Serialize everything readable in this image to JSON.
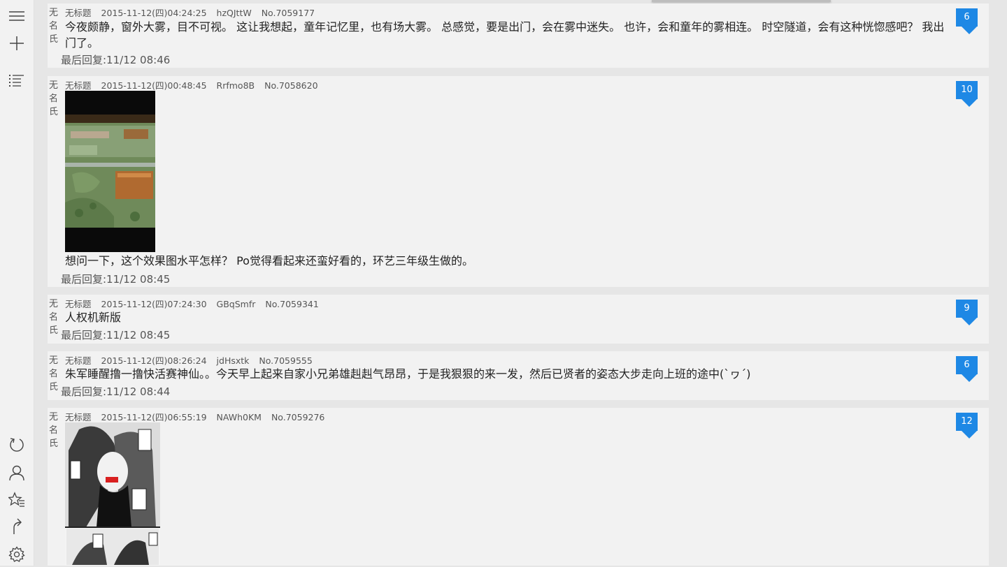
{
  "sidebar": {
    "top": [
      "menu-icon",
      "add-icon",
      "list-icon"
    ],
    "bottom": [
      "refresh-icon",
      "user-icon",
      "favorites-icon",
      "redo-icon",
      "settings-icon"
    ]
  },
  "posts": [
    {
      "author": "无名氏",
      "title": "无标题",
      "time": "2015-11-12(四)04:24:25",
      "uid": "hzQJttW",
      "no": "No.7059177",
      "content": "今夜颇静，窗外大雾，目不可视。 这让我想起，童年记忆里，也有场大雾。 总感觉，要是出门，会在雾中迷失。 也许，会和童年的雾相连。 时空隧道，会有这种恍惚感吧？ 我出门了。",
      "last_reply": "最后回复:11/12 08:46",
      "replies": "6"
    },
    {
      "author": "无名氏",
      "title": "无标题",
      "time": "2015-11-12(四)00:48:45",
      "uid": "Rrfmo8B",
      "no": "No.7058620",
      "image": "landscape-model-photo",
      "content": "想问一下，这个效果图水平怎样？ Po觉得看起来还蛮好看的，环艺三年级生做的。",
      "last_reply": "最后回复:11/12 08:45",
      "replies": "10"
    },
    {
      "author": "无名氏",
      "title": "无标题",
      "time": "2015-11-12(四)07:24:30",
      "uid": "GBqSmfr",
      "no": "No.7059341",
      "content": "人权机新版",
      "last_reply": "最后回复:11/12 08:45",
      "replies": "9"
    },
    {
      "author": "无名氏",
      "title": "无标题",
      "time": "2015-11-12(四)08:26:24",
      "uid": "jdHsxtk",
      "no": "No.7059555",
      "content": "朱军睡醒撸一撸快活赛神仙。。今天早上起来自家小兄弟雄赳赳气昂昂，于是我狠狠的来一发，然后已贤者的姿态大步走向上班的途中(`ヮ´)",
      "last_reply": "最后回复:11/12 08:44",
      "replies": "6"
    },
    {
      "author": "无名氏",
      "title": "无标题",
      "time": "2015-11-12(四)06:55:19",
      "uid": "NAWh0KM",
      "no": "No.7059276",
      "image": "manga-page",
      "content": "",
      "last_reply": "",
      "replies": "12"
    }
  ],
  "colors": {
    "accent": "#1e88e5",
    "card": "#f2f2f2",
    "background": "#e6e6e6"
  }
}
